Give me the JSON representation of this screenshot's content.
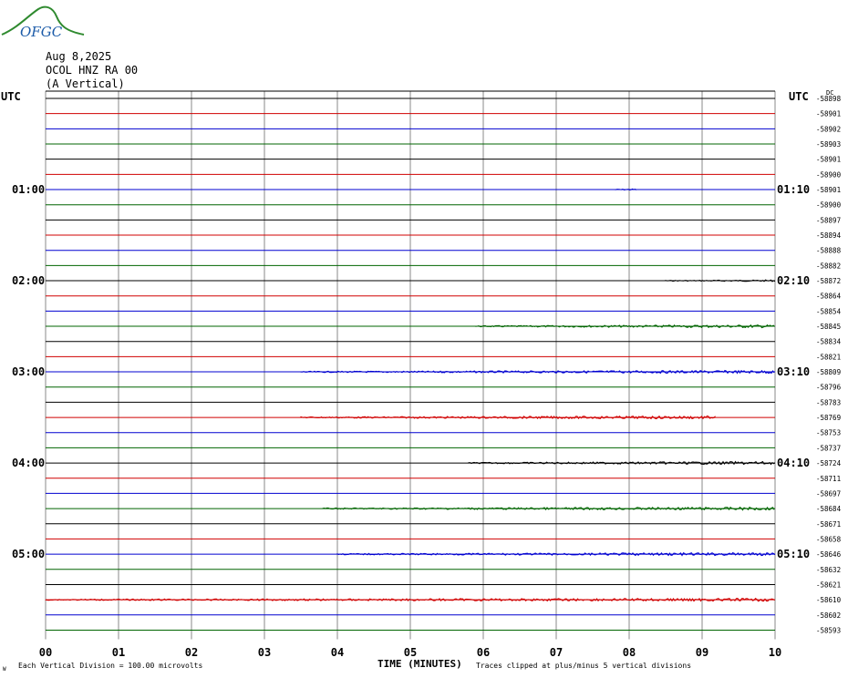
{
  "logo": {
    "text": "OFGC"
  },
  "header": {
    "date": "Aug 8,2025",
    "station": "OCOL HNZ RA 00",
    "component": "(A Vertical)"
  },
  "chart_data": {
    "type": "line",
    "title": "Aug 8,2025",
    "xlabel": "TIME (MINUTES)",
    "ylabel": "",
    "left_header": "UTC",
    "right_header": "UTC",
    "dc_header": "DC",
    "x_ticks": [
      "00",
      "01",
      "02",
      "03",
      "04",
      "05",
      "06",
      "07",
      "08",
      "09",
      "10"
    ],
    "left_time_labels": [
      {
        "row": 6,
        "label": "01:00"
      },
      {
        "row": 12,
        "label": "02:00"
      },
      {
        "row": 18,
        "label": "03:00"
      },
      {
        "row": 24,
        "label": "04:00"
      },
      {
        "row": 30,
        "label": "05:00"
      }
    ],
    "right_time_labels": [
      {
        "row": 6,
        "label": "01:10"
      },
      {
        "row": 12,
        "label": "02:10"
      },
      {
        "row": 18,
        "label": "03:10"
      },
      {
        "row": 24,
        "label": "04:10"
      },
      {
        "row": 30,
        "label": "05:10"
      }
    ],
    "trace_colors": [
      "#000000",
      "#d00000",
      "#0000d0",
      "#006400"
    ],
    "dc_offsets": [
      -58898,
      -58901,
      -58902,
      -58903,
      -58901,
      -58900,
      -58901,
      -58900,
      -58897,
      -58894,
      -58888,
      -58882,
      -58872,
      -58864,
      -58854,
      -58845,
      -58834,
      -58821,
      -58809,
      -58796,
      -58783,
      -58769,
      -58753,
      -58737,
      -58724,
      -58711,
      -58697,
      -58684,
      -58671,
      -58658,
      -58646,
      -58632,
      -58621,
      -58610,
      -58602,
      -58593
    ],
    "trace_activity": [
      {
        "row": 6,
        "start_min": 7.8,
        "end_min": 8.1,
        "level": "low"
      },
      {
        "row": 12,
        "start_min": 8.5,
        "end_min": 10,
        "level": "low"
      },
      {
        "row": 15,
        "start_min": 5.9,
        "end_min": 10,
        "level": "medium"
      },
      {
        "row": 18,
        "start_min": 3.5,
        "end_min": 10,
        "level": "medium"
      },
      {
        "row": 21,
        "start_min": 3.5,
        "end_min": 9.2,
        "level": "medium"
      },
      {
        "row": 24,
        "start_min": 5.8,
        "end_min": 10,
        "level": "medium"
      },
      {
        "row": 27,
        "start_min": 3.8,
        "end_min": 10,
        "level": "medium"
      },
      {
        "row": 30,
        "start_min": 4.0,
        "end_min": 10,
        "level": "medium"
      },
      {
        "row": 33,
        "start_min": 0.0,
        "end_min": 10,
        "level": "medium"
      }
    ],
    "grid": true
  },
  "footer": {
    "vertical_division_note": "Each Vertical Division =  100.00 microvolts",
    "clip_note": "Traces clipped at plus/minus 5 vertical divisions",
    "corner_mark": "W"
  }
}
